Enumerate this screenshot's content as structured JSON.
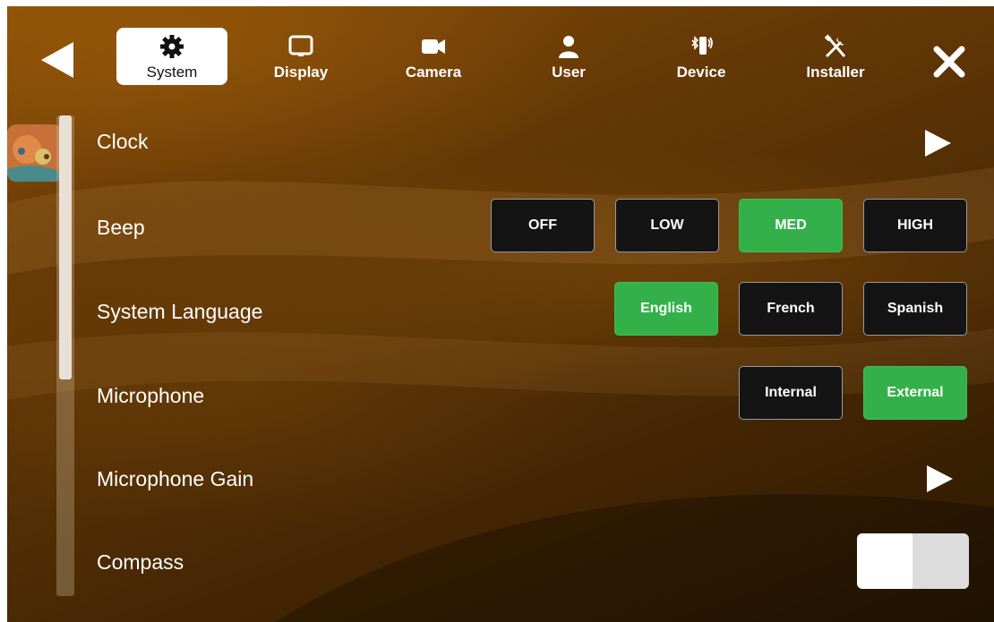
{
  "tabs": [
    {
      "label": "System",
      "icon": "gear-icon",
      "active": true
    },
    {
      "label": "Display",
      "icon": "monitor-icon",
      "active": false
    },
    {
      "label": "Camera",
      "icon": "video-camera-icon",
      "active": false
    },
    {
      "label": "User",
      "icon": "user-icon",
      "active": false
    },
    {
      "label": "Device",
      "icon": "bluetooth-device-icon",
      "active": false
    },
    {
      "label": "Installer",
      "icon": "tools-icon",
      "active": false
    }
  ],
  "settings": {
    "clock": {
      "label": "Clock"
    },
    "beep": {
      "label": "Beep",
      "options": [
        "OFF",
        "LOW",
        "MED",
        "HIGH"
      ],
      "selected": "MED"
    },
    "language": {
      "label": "System Language",
      "options": [
        "English",
        "French",
        "Spanish"
      ],
      "selected": "English"
    },
    "microphone": {
      "label": "Microphone",
      "options": [
        "Internal",
        "External"
      ],
      "selected": "External"
    },
    "mic_gain": {
      "label": "Microphone Gain"
    },
    "compass": {
      "label": "Compass",
      "enabled": false
    }
  },
  "colors": {
    "accent": "#34b04a",
    "button_bg": "#141414",
    "background": "#6b3c06"
  }
}
